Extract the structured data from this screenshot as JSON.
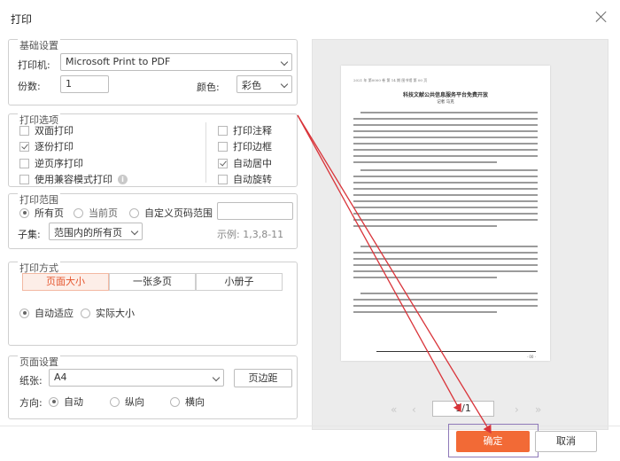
{
  "dialog": {
    "title": "打印"
  },
  "basic": {
    "title": "基础设置",
    "printer_label": "打印机:",
    "printer_value": "Microsoft Print to PDF",
    "copies_label": "份数:",
    "copies_value": "1",
    "color_label": "颜色:",
    "color_value": "彩色"
  },
  "options": {
    "title": "打印选项",
    "left": [
      {
        "label": "双面打印",
        "checked": false
      },
      {
        "label": "逐份打印",
        "checked": true
      },
      {
        "label": "逆页序打印",
        "checked": false
      },
      {
        "label": "使用兼容模式打印",
        "checked": false
      }
    ],
    "right": [
      {
        "label": "打印注释",
        "checked": false
      },
      {
        "label": "打印边框",
        "checked": false
      },
      {
        "label": "自动居中",
        "checked": true
      },
      {
        "label": "自动旋转",
        "checked": false
      }
    ]
  },
  "range": {
    "title": "打印范围",
    "all_pages": "所有页",
    "current_page": "当前页",
    "custom_range": "自定义页码范围",
    "subset_label": "子集:",
    "subset_value": "范围内的所有页",
    "example": "示例: 1,3,8-11"
  },
  "mode": {
    "title": "打印方式",
    "tabs": [
      "页面大小",
      "一张多页",
      "小册子"
    ],
    "auto_fit": "自动适应",
    "actual_size": "实际大小"
  },
  "page_setup": {
    "title": "页面设置",
    "paper_label": "纸张:",
    "paper_value": "A4",
    "margin_button": "页边距",
    "orientation_label": "方向:",
    "orientations": [
      "自动",
      "纵向",
      "横向"
    ]
  },
  "preview": {
    "doc_header": "2021 年 第0000 卷 第 14 期 图书馆 第 00 页",
    "doc_title": "科技文献公共信息服务平台免费开放",
    "doc_authors": "记者    马克",
    "footer_num": "· 00 ·",
    "page_indicator": "1/1"
  },
  "buttons": {
    "ok": "确定",
    "cancel": "取消"
  },
  "colors": {
    "accent": "#f26a36",
    "annotation": "#d9343a",
    "highlight_box": "#8e79b8"
  }
}
